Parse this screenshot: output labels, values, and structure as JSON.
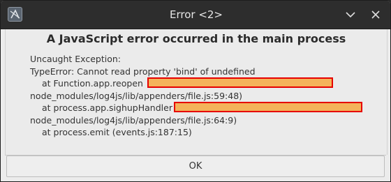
{
  "window": {
    "title": "Error <2>"
  },
  "titlebar_icons": {
    "app_icon": "app-logo-icon",
    "minimize_icon": "chevron-down-icon",
    "close_icon": "close-icon"
  },
  "dialog": {
    "heading": "A JavaScript error occurred in the main process",
    "lines": [
      "Uncaught Exception:",
      "TypeError: Cannot read property 'bind' of undefined",
      "at Function.app.reopen",
      "node_modules/log4js/lib/appenders/file.js:59:48)",
      "at process.app.sighupHandler",
      "node_modules/log4js/lib/appenders/file.js:64:9)",
      "at process.emit (events.js:187:15)"
    ],
    "ok_label": "OK"
  },
  "colors": {
    "titlebar_bg": "#2d2d2d",
    "dialog_bg": "#ebebeb",
    "redaction_fill": "#f4b35a",
    "redaction_border": "#e60000"
  }
}
